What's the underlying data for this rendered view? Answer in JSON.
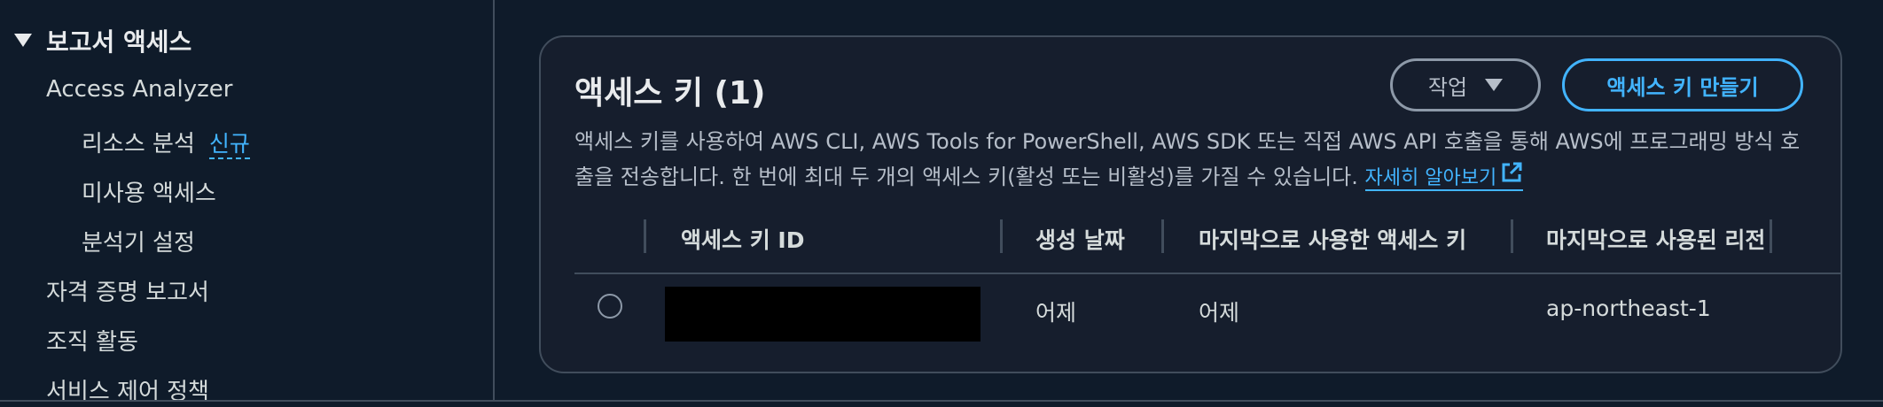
{
  "sidebar": {
    "section_title": "보고서 액세스",
    "items": [
      {
        "label": "Access Analyzer"
      },
      {
        "label": "리소스 분석",
        "badge": "신규"
      },
      {
        "label": "미사용 액세스"
      },
      {
        "label": "분석기 설정"
      },
      {
        "label": "자격 증명 보고서"
      },
      {
        "label": "조직 활동"
      },
      {
        "label": "서비스 제어 정책"
      }
    ]
  },
  "panel": {
    "title": "액세스 키 (1)",
    "actions_label": "작업",
    "create_label": "액세스 키 만들기",
    "description": "액세스 키를 사용하여 AWS CLI, AWS Tools for PowerShell, AWS SDK 또는 직접 AWS API 호출을 통해 AWS에 프로그래밍 방식 호출을 전송합니다. 한 번에 최대 두 개의 액세스 키(활성 또는 비활성)를 가질 수 있습니다.",
    "learn_more": "자세히 알아보기",
    "table": {
      "headers": [
        "액세스 키 ID",
        "생성 날짜",
        "마지막으로 사용한 액세스 키",
        "마지막으로 사용된 리전"
      ],
      "rows": [
        {
          "key_id": "",
          "created": "어제",
          "last_used": "어제",
          "region": "ap-northeast-1"
        }
      ]
    }
  },
  "colors": {
    "accent": "#42b4ff",
    "background": "#0f1b2a",
    "panel": "#161e2d",
    "border": "#414d5c"
  },
  "icons": [
    "caret-down-icon",
    "dropdown-triangle-icon",
    "external-link-icon",
    "radio-button-icon"
  ]
}
